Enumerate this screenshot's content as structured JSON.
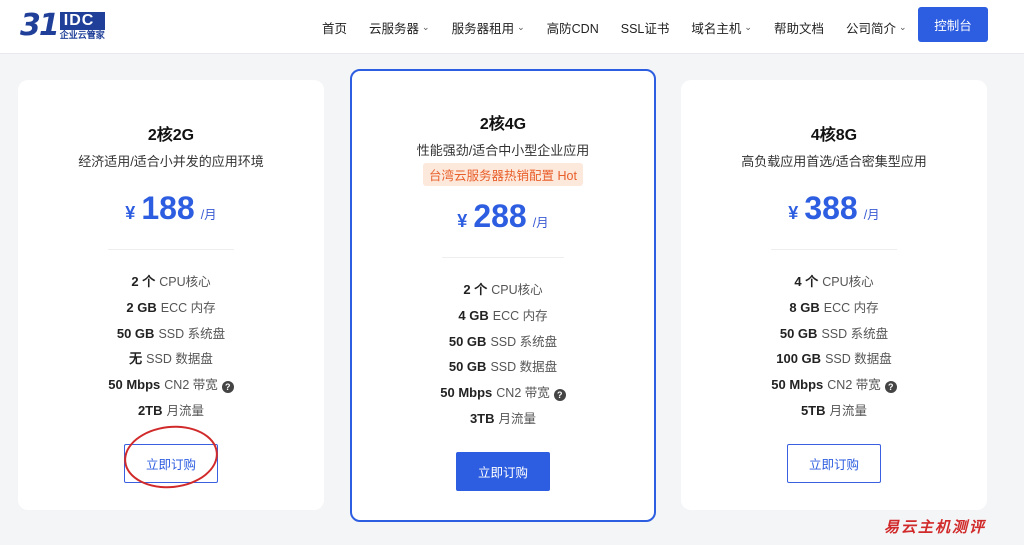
{
  "logo": {
    "mark": "31",
    "idc": "IDC",
    "sub": "企业云管家"
  },
  "nav": {
    "items": [
      {
        "label": "首页",
        "dropdown": false
      },
      {
        "label": "云服务器",
        "dropdown": true
      },
      {
        "label": "服务器租用",
        "dropdown": true
      },
      {
        "label": "高防CDN",
        "dropdown": false
      },
      {
        "label": "SSL证书",
        "dropdown": false
      },
      {
        "label": "域名主机",
        "dropdown": true
      },
      {
        "label": "帮助文档",
        "dropdown": false
      },
      {
        "label": "公司简介",
        "dropdown": true
      }
    ],
    "console_label": "控制台",
    "chevron": "⌄"
  },
  "currency_symbol": "¥",
  "unit": "/月",
  "help_glyph": "?",
  "plans": [
    {
      "title": "2核2G",
      "desc": "经济适用/适合小并发的应用环境",
      "price": "188",
      "specs": [
        {
          "value": "2 个",
          "label": "CPU核心"
        },
        {
          "value": "2 GB",
          "label": "ECC 内存"
        },
        {
          "value": "50 GB",
          "label": "SSD 系统盘"
        },
        {
          "value": "无",
          "label": "SSD 数据盘"
        },
        {
          "value": "50 Mbps",
          "label": "CN2 带宽"
        },
        {
          "value": "2TB",
          "label": "月流量"
        }
      ],
      "button": "立即订购"
    },
    {
      "title": "2核4G",
      "desc": "性能强劲/适合中小型企业应用",
      "badge": "台湾云服务器热销配置 Hot",
      "price": "288",
      "specs": [
        {
          "value": "2 个",
          "label": "CPU核心"
        },
        {
          "value": "4 GB",
          "label": "ECC 内存"
        },
        {
          "value": "50 GB",
          "label": "SSD 系统盘"
        },
        {
          "value": "50 GB",
          "label": "SSD 数据盘"
        },
        {
          "value": "50 Mbps",
          "label": "CN2 带宽"
        },
        {
          "value": "3TB",
          "label": "月流量"
        }
      ],
      "button": "立即订购"
    },
    {
      "title": "4核8G",
      "desc": "高负载应用首选/适合密集型应用",
      "price": "388",
      "specs": [
        {
          "value": "4 个",
          "label": "CPU核心"
        },
        {
          "value": "8 GB",
          "label": "ECC 内存"
        },
        {
          "value": "50 GB",
          "label": "SSD 系统盘"
        },
        {
          "value": "100 GB",
          "label": "SSD 数据盘"
        },
        {
          "value": "50 Mbps",
          "label": "CN2 带宽"
        },
        {
          "value": "5TB",
          "label": "月流量"
        }
      ],
      "button": "立即订购"
    }
  ],
  "watermark": "易云主机测评",
  "colors": {
    "accent": "#2d5de0",
    "hot_text": "#e85f2a",
    "hot_bg": "#fde8dc",
    "annotation": "#d12a2a"
  }
}
